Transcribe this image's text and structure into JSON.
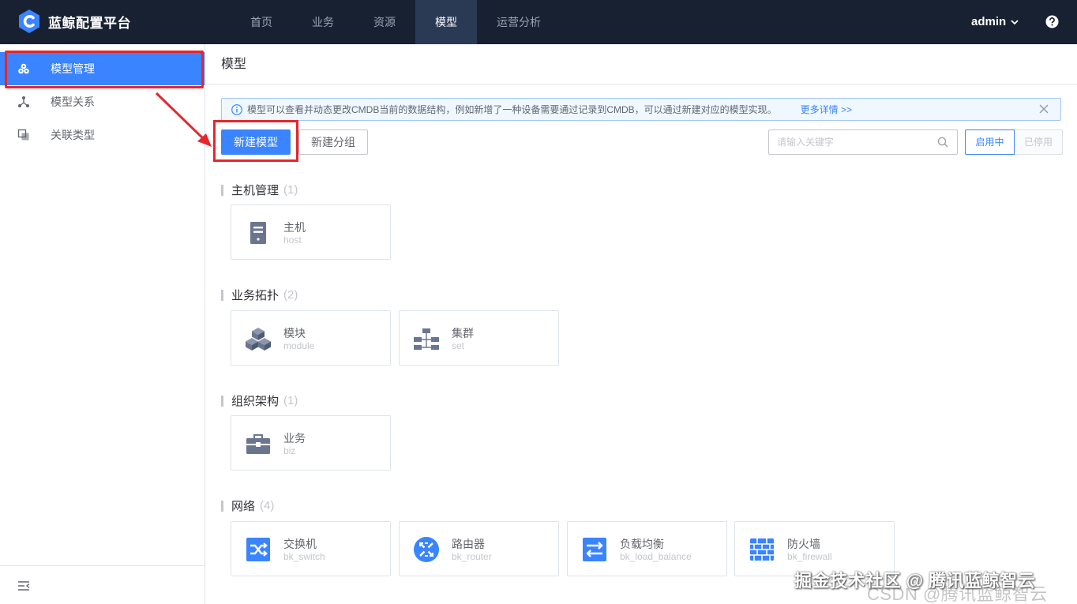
{
  "app": {
    "name": "蓝鲸配置平台"
  },
  "nav": [
    "首页",
    "业务",
    "资源",
    "模型",
    "运营分析"
  ],
  "user": {
    "name": "admin"
  },
  "sidebar": {
    "items": [
      {
        "label": "模型管理"
      },
      {
        "label": "模型关系"
      },
      {
        "label": "关联类型"
      }
    ]
  },
  "page": {
    "title": "模型"
  },
  "tips": {
    "text": "模型可以查看并动态更改CMDB当前的数据结构，例如新增了一种设备需要通过记录到CMDB，可以通过新建对应的模型实现。",
    "more": "更多详情 >>"
  },
  "toolbar": {
    "new_model": "新建模型",
    "new_group": "新建分组",
    "search_placeholder": "请输入关键字",
    "enabled": "启用中",
    "disabled": "已停用"
  },
  "groups": [
    {
      "title": "主机管理",
      "count": "(1)",
      "models": [
        {
          "name": "主机",
          "id": "host",
          "icon": "host-icon"
        }
      ]
    },
    {
      "title": "业务拓扑",
      "count": "(2)",
      "models": [
        {
          "name": "模块",
          "id": "module",
          "icon": "module-icon"
        },
        {
          "name": "集群",
          "id": "set",
          "icon": "set-icon"
        }
      ]
    },
    {
      "title": "组织架构",
      "count": "(1)",
      "models": [
        {
          "name": "业务",
          "id": "biz",
          "icon": "biz-icon"
        }
      ]
    },
    {
      "title": "网络",
      "count": "(4)",
      "models": [
        {
          "name": "交换机",
          "id": "bk_switch",
          "icon": "switch-icon"
        },
        {
          "name": "路由器",
          "id": "bk_router",
          "icon": "router-icon"
        },
        {
          "name": "负载均衡",
          "id": "bk_load_balance",
          "icon": "load-balance-icon"
        },
        {
          "name": "防火墙",
          "id": "bk_firewall",
          "icon": "firewall-icon"
        }
      ]
    }
  ],
  "watermark": "掘金技术社区 @ 腾讯蓝鲸智云",
  "watermark2": "CSDN @腾讯蓝鲸智云",
  "colors": {
    "primary": "#3a84ff",
    "topbar": "#182132",
    "highlight": "#e6262c"
  }
}
